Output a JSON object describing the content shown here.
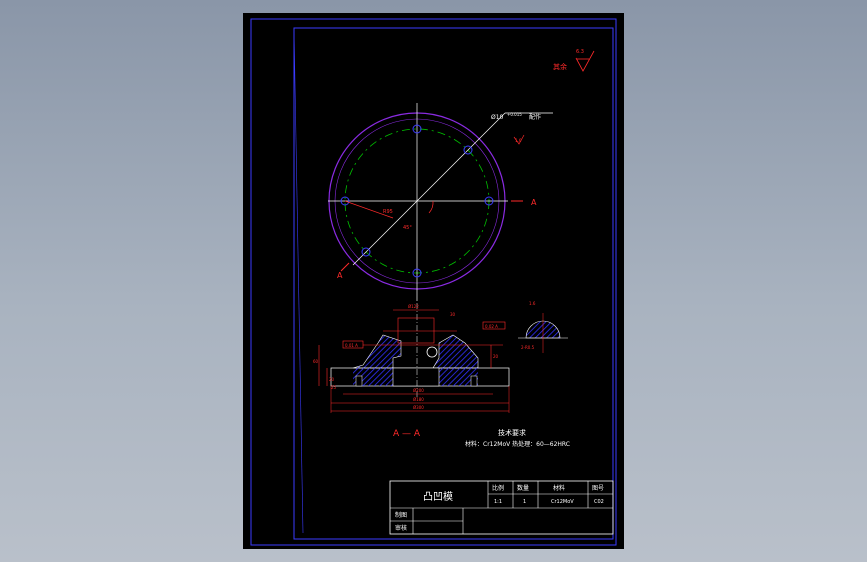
{
  "title_block": {
    "part_name": "凸凹模",
    "headers": [
      "比例",
      "数量",
      "材料",
      "图号"
    ],
    "values": [
      "1:1",
      "1",
      "Cr12MoV",
      "C02"
    ],
    "drawn_label": "制图",
    "checked_label": "审核"
  },
  "roughness_symbol": {
    "label": "其余",
    "value": "6.3"
  },
  "hole_callout": {
    "text": "Ø10",
    "tolerance": "+0.015",
    "suffix": "配作"
  },
  "section_marker": {
    "letter": "A"
  },
  "section_title": "A — A",
  "tech_requirements": {
    "heading": "技术要求",
    "line": "材料：Cr12MoV  热处理：60—62HRC"
  },
  "dimensions": {
    "bolt_circle": "R95",
    "angle": "45°",
    "top_width": "Ø122",
    "overall_width": "Ø300",
    "inner_width": "Ø180",
    "flange_height": "40",
    "left_height": "60",
    "hub_height": "30",
    "small_left": "20",
    "right_dim": "20",
    "base_thickness": "25",
    "groove_callout": "2-R0.5",
    "tolerance_box": "0.02 A",
    "left_gdt": "0.01 A",
    "bottom_dim": "Ø200",
    "roughness_small": "1.6"
  },
  "colors": {
    "sheet": "#000000",
    "frame": "#3b3bff",
    "outer_circle": "#8a2be2",
    "center_circle": "#00c000",
    "dimension": "#ff2a2a",
    "outline": "#ffffff",
    "hatch": "#3030ff"
  }
}
